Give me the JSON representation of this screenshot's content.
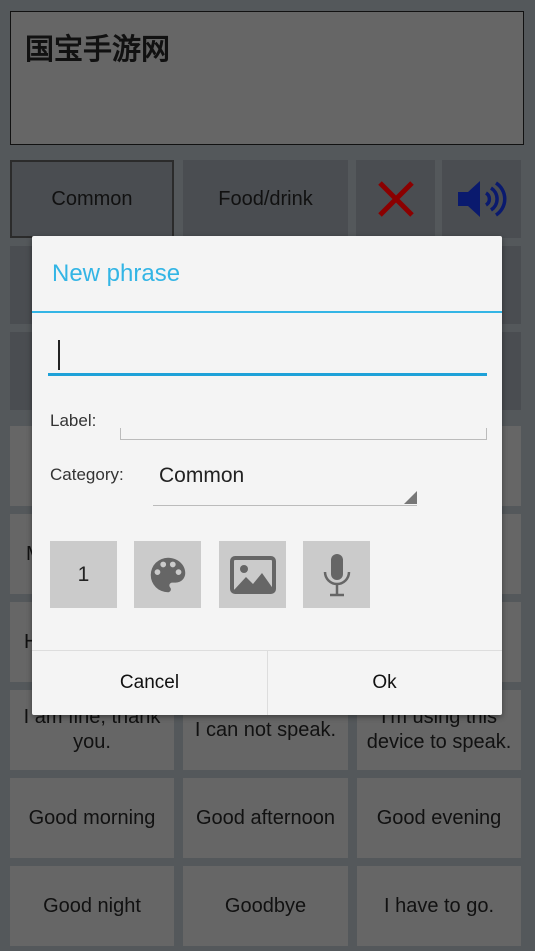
{
  "textbox": {
    "text": "国宝手游网"
  },
  "categories": [
    {
      "label": "Common",
      "selected": true
    },
    {
      "label": "Food/drink",
      "selected": false
    }
  ],
  "toolbar": {
    "clear_icon": "close-icon",
    "clear_color": "#8b0000",
    "speak_icon": "speaker-icon",
    "speak_color": "#0a1a6e"
  },
  "grid": {
    "partial": [
      "M",
      "H"
    ],
    "rows": [
      [
        "I am fine, thank you.",
        "I can not speak.",
        "I'm using this device to speak."
      ],
      [
        "Good morning",
        "Good afternoon",
        "Good evening"
      ],
      [
        "Good night",
        "Goodbye",
        "I have to go."
      ]
    ]
  },
  "dialog": {
    "title": "New phrase",
    "phrase_value": "",
    "label_label": "Label:",
    "label_value": "",
    "category_label": "Category:",
    "category_value": "Common",
    "number_button": "1",
    "icons": [
      "palette-icon",
      "image-icon",
      "microphone-icon"
    ],
    "cancel": "Cancel",
    "ok": "Ok",
    "accent": "#33b5e5"
  }
}
